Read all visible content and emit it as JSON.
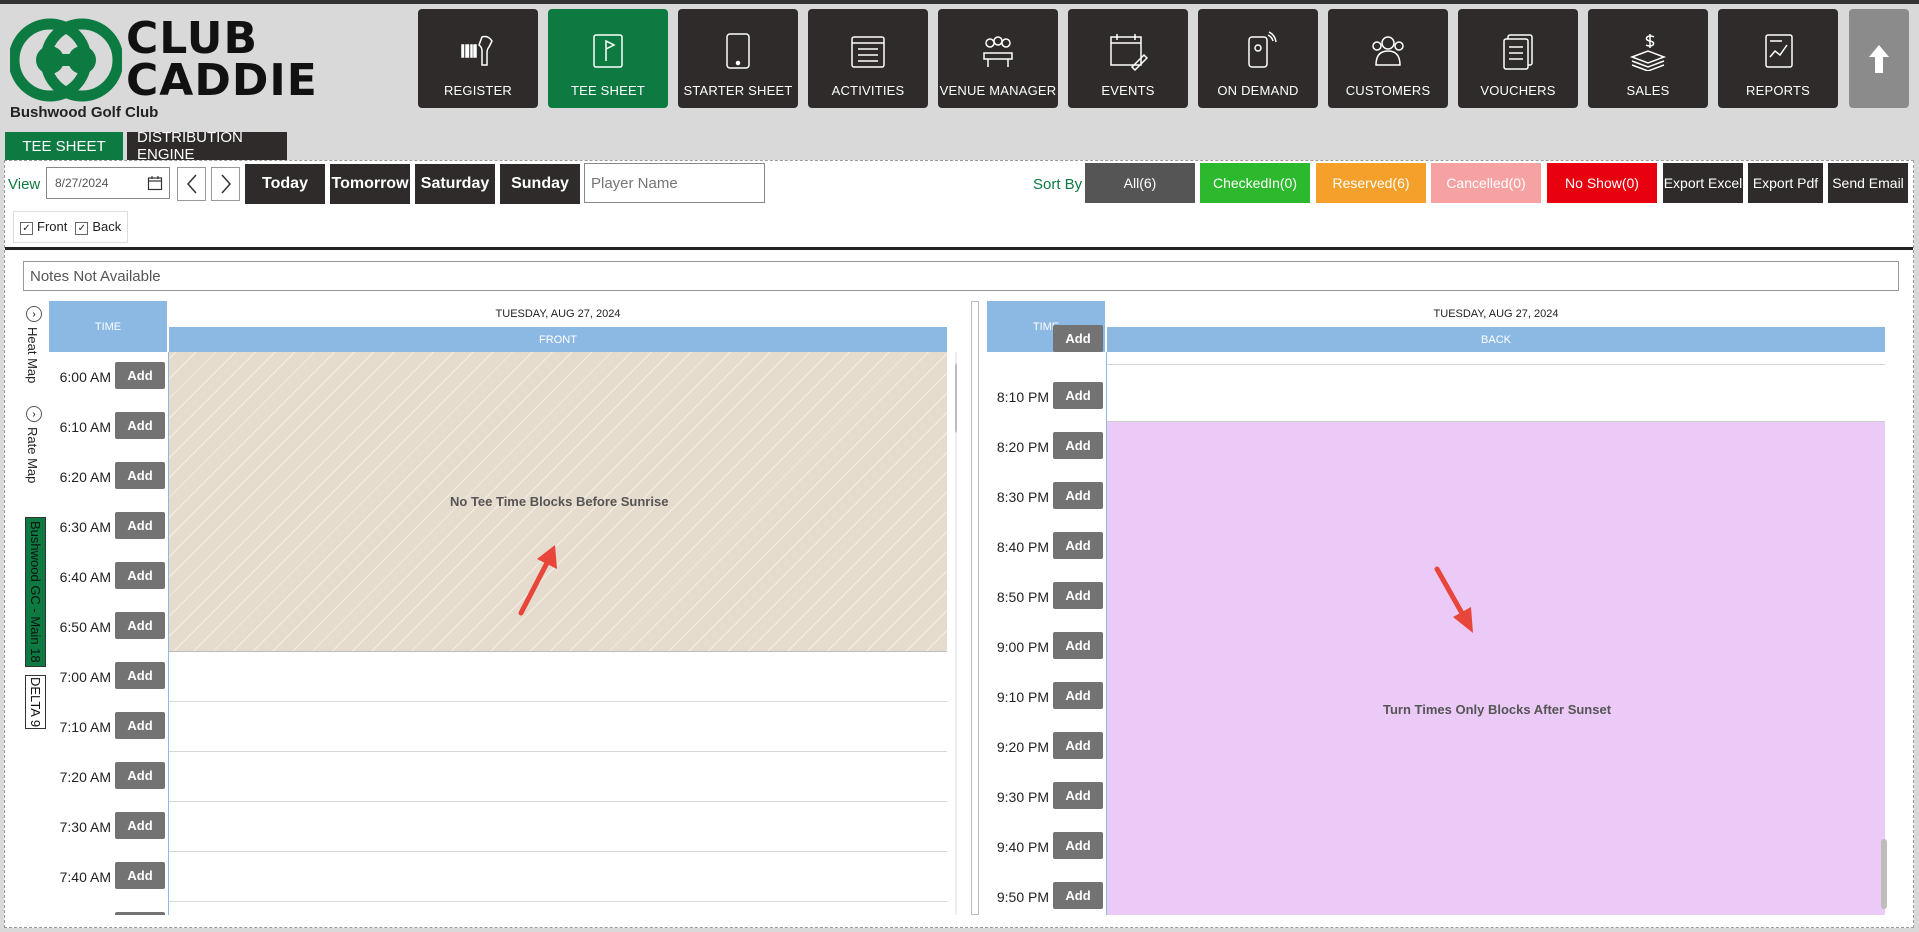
{
  "brand": {
    "logo_text_1": "CLUB",
    "logo_text_2": "CADDIE",
    "club_name": "Bushwood Golf Club",
    "accent": "#0d7a41"
  },
  "nav": [
    {
      "label": "REGISTER",
      "icon": "barcode-scanner-icon"
    },
    {
      "label": "TEE SHEET",
      "icon": "flag-icon",
      "active": true
    },
    {
      "label": "STARTER SHEET",
      "icon": "tablet-icon"
    },
    {
      "label": "ACTIVITIES",
      "icon": "list-icon"
    },
    {
      "label": "VENUE MANAGER",
      "icon": "people-table-icon"
    },
    {
      "label": "EVENTS",
      "icon": "calendar-edit-icon"
    },
    {
      "label": "ON DEMAND",
      "icon": "phone-icon"
    },
    {
      "label": "CUSTOMERS",
      "icon": "customers-icon"
    },
    {
      "label": "VOUCHERS",
      "icon": "voucher-icon"
    },
    {
      "label": "SALES",
      "icon": "money-icon"
    },
    {
      "label": "REPORTS",
      "icon": "report-icon"
    }
  ],
  "tabs": {
    "tee_sheet": "TEE SHEET",
    "distribution": "DISTRIBUTION ENGINE"
  },
  "toolbar": {
    "view_label": "View",
    "date": "8/27/2024",
    "today": "Today",
    "tomorrow": "Tomorrow",
    "saturday": "Saturday",
    "sunday": "Sunday",
    "player_placeholder": "Player Name",
    "sort_by": "Sort By",
    "all": "All(6)",
    "checked_in": "CheckedIn(0)",
    "reserved": "Reserved(6)",
    "cancelled": "Cancelled(0)",
    "no_show": "No Show(0)",
    "export_excel": "Export Excel",
    "export_pdf": "Export Pdf",
    "send_email": "Send Email"
  },
  "filters": {
    "front": "Front",
    "back": "Back"
  },
  "notes": "Notes Not Available",
  "side": {
    "heat_map": "Heat Map",
    "rate_map": "Rate Map",
    "course": "Bushwood GC - Main 18",
    "delta": "DELTA 9"
  },
  "front": {
    "time_header": "TIME",
    "date_header": "TUESDAY, AUG 27, 2024",
    "course_header": "FRONT",
    "block_label": "No Tee Time Blocks Before Sunrise",
    "times": [
      "6:00 AM",
      "6:10 AM",
      "6:20 AM",
      "6:30 AM",
      "6:40 AM",
      "6:50 AM",
      "7:00 AM",
      "7:10 AM",
      "7:20 AM",
      "7:30 AM",
      "7:40 AM"
    ],
    "add_label": "Add"
  },
  "back": {
    "time_header": "TIME",
    "date_header": "TUESDAY, AUG 27, 2024",
    "course_header": "BACK",
    "block_label": "Turn Times Only Blocks After Sunset",
    "times": [
      "8:10 PM",
      "8:20 PM",
      "8:30 PM",
      "8:40 PM",
      "8:50 PM",
      "9:00 PM",
      "9:10 PM",
      "9:20 PM",
      "9:30 PM",
      "9:40 PM",
      "9:50 PM"
    ],
    "add_label": "Add"
  }
}
